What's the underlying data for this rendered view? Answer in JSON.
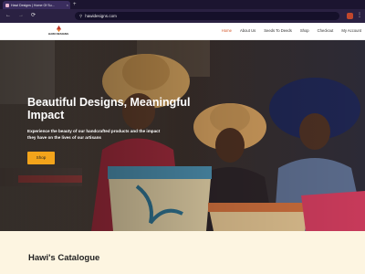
{
  "browser": {
    "tab_title": "Hawi Designs | Home Of Su...",
    "url": "hawidesigns.com",
    "new_tab_label": "+"
  },
  "site": {
    "logo_text": "HAWI DESIGNS",
    "nav": [
      {
        "label": "Home",
        "active": true
      },
      {
        "label": "About Us"
      },
      {
        "label": "Seeds To Deeds"
      },
      {
        "label": "Shop"
      },
      {
        "label": "Checkout"
      },
      {
        "label": "My Account"
      }
    ]
  },
  "hero": {
    "title": "Beautiful Designs, Meaningful Impact",
    "subtitle": "Experience the beauty of our handcrafted products and the impact they have on the lives of our artisans",
    "button_label": "Shop"
  },
  "catalogue": {
    "title": "Hawi's Catalogue"
  },
  "colors": {
    "accent": "#f3a41b",
    "nav_active": "#d4572a",
    "catalogue_bg": "#fdf5e1",
    "browser_chrome": "#2a2142"
  },
  "icons": [
    "back-icon",
    "forward-icon",
    "reload-icon",
    "site-info-icon",
    "extension-icon",
    "menu-icon",
    "logo-icon"
  ]
}
